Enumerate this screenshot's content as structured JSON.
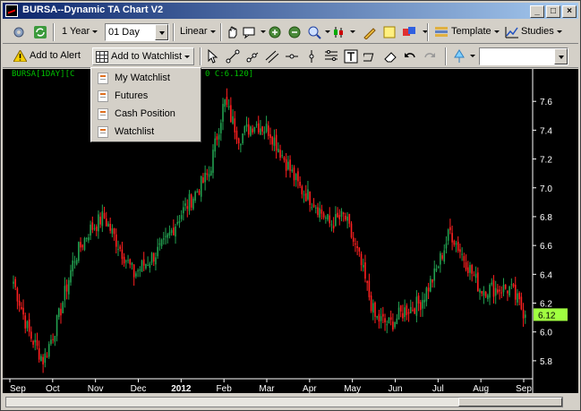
{
  "window": {
    "title": "BURSA--Dynamic TA Chart V2",
    "minimize": "_",
    "maximize": "□",
    "close": "×"
  },
  "toolbar1": {
    "range": "1 Year",
    "interval": "01 Day",
    "scale": "Linear",
    "template": "Template",
    "studies": "Studies"
  },
  "toolbar2": {
    "add_alert": "Add to Alert",
    "add_watchlist": "Add to Watchlist"
  },
  "watchlist_menu": {
    "items": [
      "My Watchlist",
      "Futures",
      "Cash Position",
      "Watchlist"
    ]
  },
  "chart": {
    "label_left": "BURSA[1DAY][C",
    "label_right": "0 C:6.120]",
    "last_price_label": "6.12",
    "up_color": "#22a050",
    "down_color": "#ff2020",
    "last_price_color": "#a0ff40"
  },
  "chart_data": {
    "type": "candlestick",
    "title": "",
    "symbol": "BURSA",
    "ylim": [
      5.7,
      7.8
    ],
    "y_ticks": [
      5.8,
      6.0,
      6.2,
      6.4,
      6.6,
      6.8,
      7.0,
      7.2,
      7.4,
      7.6
    ],
    "x_tick_labels": [
      "Sep",
      "Oct",
      "Nov",
      "Dec",
      "2012",
      "Feb",
      "Mar",
      "Apr",
      "May",
      "Jun",
      "Jul",
      "Aug",
      "Sep"
    ],
    "close_path": [
      [
        "Sep",
        6.35
      ],
      [
        "Sep",
        6.0
      ],
      [
        "Sep",
        5.8
      ],
      [
        "Oct",
        6.1
      ],
      [
        "Oct",
        6.5
      ],
      [
        "Oct",
        6.7
      ],
      [
        "Nov",
        6.8
      ],
      [
        "Nov",
        6.6
      ],
      [
        "Nov",
        6.4
      ],
      [
        "Dec",
        6.5
      ],
      [
        "Dec",
        6.6
      ],
      [
        "2012",
        6.8
      ],
      [
        "2012",
        6.95
      ],
      [
        "Feb",
        7.1
      ],
      [
        "Feb",
        7.6
      ],
      [
        "Feb",
        7.35
      ],
      [
        "Mar",
        7.45
      ],
      [
        "Mar",
        7.4
      ],
      [
        "Apr",
        7.2
      ],
      [
        "Apr",
        7.0
      ],
      [
        "Apr",
        6.9
      ],
      [
        "May",
        6.75
      ],
      [
        "May",
        6.8
      ],
      [
        "May",
        6.5
      ],
      [
        "Jun",
        6.1
      ],
      [
        "Jun",
        6.05
      ],
      [
        "Jun",
        6.15
      ],
      [
        "Jul",
        6.2
      ],
      [
        "Jul",
        6.4
      ],
      [
        "Jul",
        6.7
      ],
      [
        "Aug",
        6.5
      ],
      [
        "Aug",
        6.3
      ],
      [
        "Aug",
        6.3
      ],
      [
        "Sep",
        6.3
      ],
      [
        "Sep",
        6.12
      ]
    ],
    "last_close": 6.12
  }
}
